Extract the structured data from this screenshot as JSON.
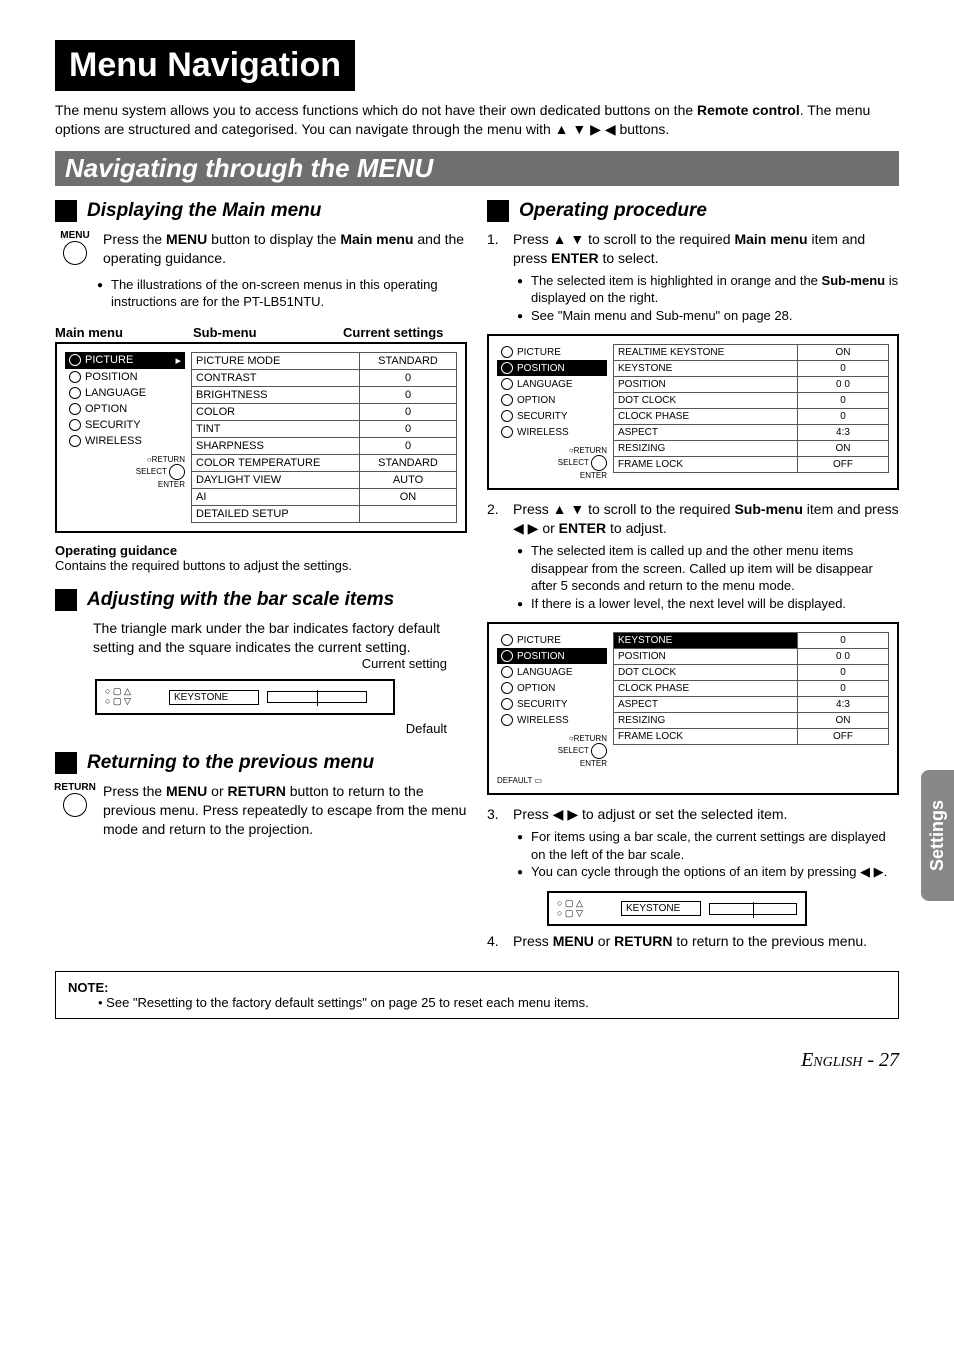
{
  "title": "Menu Navigation",
  "intro_a": "The menu system allows you to access functions which do not have their own dedicated buttons on the ",
  "intro_b": "Remote control",
  "intro_c": ". The menu options are structured and categorised. You can navigate through the menu with ▲ ▼ ▶ ◀ buttons.",
  "section": "Navigating through the MENU",
  "left": {
    "h1": "Displaying the Main menu",
    "menu_label": "MENU",
    "p1a": "Press the ",
    "p1b": "MENU",
    "p1c": " button to display the ",
    "p1d": "Main menu",
    "p1e": " and the operating guidance.",
    "b1": "The illustrations of the on-screen menus in this operating instructions are for the PT-LB51NTU.",
    "lbl_main": "Main menu",
    "lbl_sub": "Sub-menu",
    "lbl_cs": "Current settings",
    "menu_items": [
      "PICTURE",
      "POSITION",
      "LANGUAGE",
      "OPTION",
      "SECURITY",
      "WIRELESS"
    ],
    "sub_rows": [
      {
        "n": "PICTURE MODE",
        "v": "STANDARD"
      },
      {
        "n": "CONTRAST",
        "v": "0"
      },
      {
        "n": "BRIGHTNESS",
        "v": "0"
      },
      {
        "n": "COLOR",
        "v": "0"
      },
      {
        "n": "TINT",
        "v": "0"
      },
      {
        "n": "SHARPNESS",
        "v": "0"
      },
      {
        "n": "COLOR TEMPERATURE",
        "v": "STANDARD"
      },
      {
        "n": "DAYLIGHT VIEW",
        "v": "AUTO"
      },
      {
        "n": "AI",
        "v": "ON"
      },
      {
        "n": "DETAILED SETUP",
        "v": ""
      }
    ],
    "nav_return": "RETURN",
    "nav_select": "SELECT",
    "nav_enter": "ENTER",
    "og_h": "Operating guidance",
    "og_t": "Contains the required buttons to adjust the settings.",
    "h2": "Adjusting with the bar scale items",
    "p2": "The triangle mark under the bar indicates factory default setting and the square indicates the current setting.",
    "cs": "Current setting",
    "keystone": "KEYSTONE",
    "def": "Default",
    "h3": "Returning to the previous menu",
    "return_label": "RETURN",
    "p3a": "Press the ",
    "p3b": "MENU",
    "p3c": " or ",
    "p3d": "RETURN",
    "p3e": " button to return to the previous menu. Press repeatedly to escape from the menu mode and return to the projection."
  },
  "right": {
    "h1": "Operating procedure",
    "s1a": "Press ▲ ▼ to scroll to the required ",
    "s1b": "Main menu",
    "s1c": " item and press ",
    "s1d": "ENTER",
    "s1e": " to select.",
    "b1a": "The selected item is highlighted in orange and the ",
    "b1b": "Sub-menu",
    "b1c": " is displayed on the right.",
    "b2": "See \"Main menu and Sub-menu\" on page 28.",
    "d1_rows": [
      {
        "n": "REALTIME KEYSTONE",
        "v": "ON"
      },
      {
        "n": "KEYSTONE",
        "v": "0"
      },
      {
        "n": "POSITION",
        "v": "0      0"
      },
      {
        "n": "DOT CLOCK",
        "v": "0"
      },
      {
        "n": "CLOCK PHASE",
        "v": "0"
      },
      {
        "n": "ASPECT",
        "v": "4:3"
      },
      {
        "n": "RESIZING",
        "v": "ON"
      },
      {
        "n": "FRAME LOCK",
        "v": "OFF"
      }
    ],
    "s2a": "Press ▲ ▼ to scroll to the required ",
    "s2b": "Sub-menu",
    "s2c": " item and press ◀ ▶ or ",
    "s2d": "ENTER",
    "s2e": " to adjust.",
    "b3": "The selected item is called up and the other menu items disappear from the screen. Called up item will be disappear after 5 seconds and return to the menu mode.",
    "b4": "If there is a lower level, the next level will be displayed.",
    "d2_rows": [
      {
        "n": "KEYSTONE",
        "v": "0"
      },
      {
        "n": "POSITION",
        "v": "0      0"
      },
      {
        "n": "DOT CLOCK",
        "v": "0"
      },
      {
        "n": "CLOCK PHASE",
        "v": "0"
      },
      {
        "n": "ASPECT",
        "v": "4:3"
      },
      {
        "n": "RESIZING",
        "v": "ON"
      },
      {
        "n": "FRAME LOCK",
        "v": "OFF"
      }
    ],
    "def_label": "DEFAULT",
    "s3": "Press ◀ ▶ to adjust or set the selected item.",
    "b5": "For items using a bar scale, the current settings are displayed on the left of the bar scale.",
    "b6": "You can cycle through the options of an item by pressing ◀ ▶.",
    "keystone": "KEYSTONE",
    "s4a": "Press ",
    "s4b": "MENU",
    "s4c": " or ",
    "s4d": "RETURN",
    "s4e": " to return to the previous menu."
  },
  "note_h": "NOTE:",
  "note_t": "See \"Resetting to the factory default settings\" on page 25 to reset each menu items.",
  "side": "Settings",
  "footer_lang": "English",
  "footer_page": " - 27"
}
